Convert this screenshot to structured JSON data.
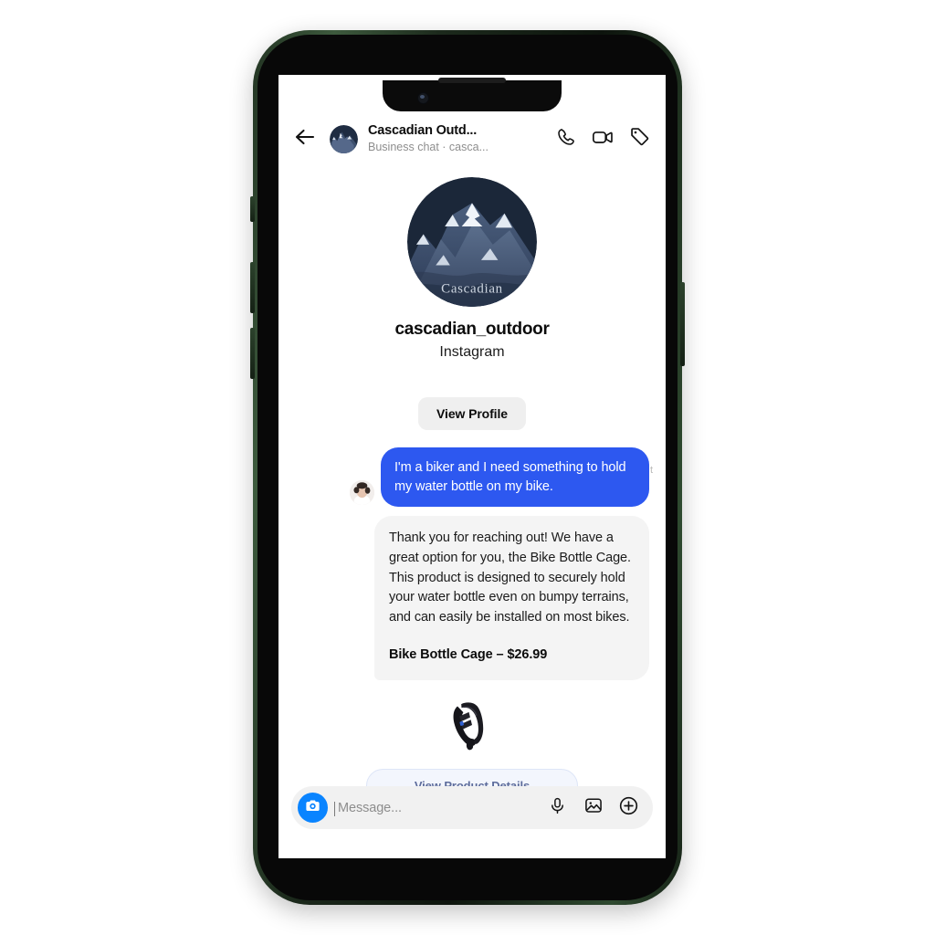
{
  "header": {
    "back_icon": "back-arrow-icon",
    "avatar_icon": "cascadian-logo-avatar",
    "title": "Cascadian Outd...",
    "subtitle": "Business chat · casca...",
    "actions": [
      {
        "name": "audio-call",
        "icon": "phone-icon"
      },
      {
        "name": "video-call",
        "icon": "video-camera-icon"
      },
      {
        "name": "shop-tag",
        "icon": "price-tag-icon"
      }
    ]
  },
  "profile": {
    "avatar_alt": "Cascadian mountain logo",
    "avatar_wordmark": "Cascadian",
    "username": "cascadian_outdoor",
    "platform": "Instagram",
    "view_profile_label": "View Profile"
  },
  "conversation": {
    "outgoing": {
      "avatar_alt": "user avatar",
      "text": "I'm a biker and I need something to hold my water bottle on my bike.",
      "stray_char": "t"
    },
    "incoming": {
      "body": "Thank you for reaching out! We have a great option for you, the Bike Bottle Cage. This product is designed to securely hold your water bottle even on bumpy terrains, and can easily be installed on most bikes.",
      "product_line": "Bike Bottle Cage – $26.99",
      "product_image_alt": "black bike bottle cage",
      "cta_label": "View Product Details"
    }
  },
  "composer": {
    "camera_icon": "camera-icon",
    "placeholder": "Message...",
    "icons": [
      {
        "name": "microphone",
        "icon": "microphone-icon"
      },
      {
        "name": "gallery",
        "icon": "image-icon"
      },
      {
        "name": "more",
        "icon": "plus-circle-icon"
      }
    ]
  },
  "colors": {
    "outgoing_bubble": "#2d58f0",
    "incoming_bubble": "#f4f4f4",
    "accent_blue": "#0a84ff",
    "cta_text": "#5e6d9c",
    "frame_green": "#3d5a3d"
  }
}
